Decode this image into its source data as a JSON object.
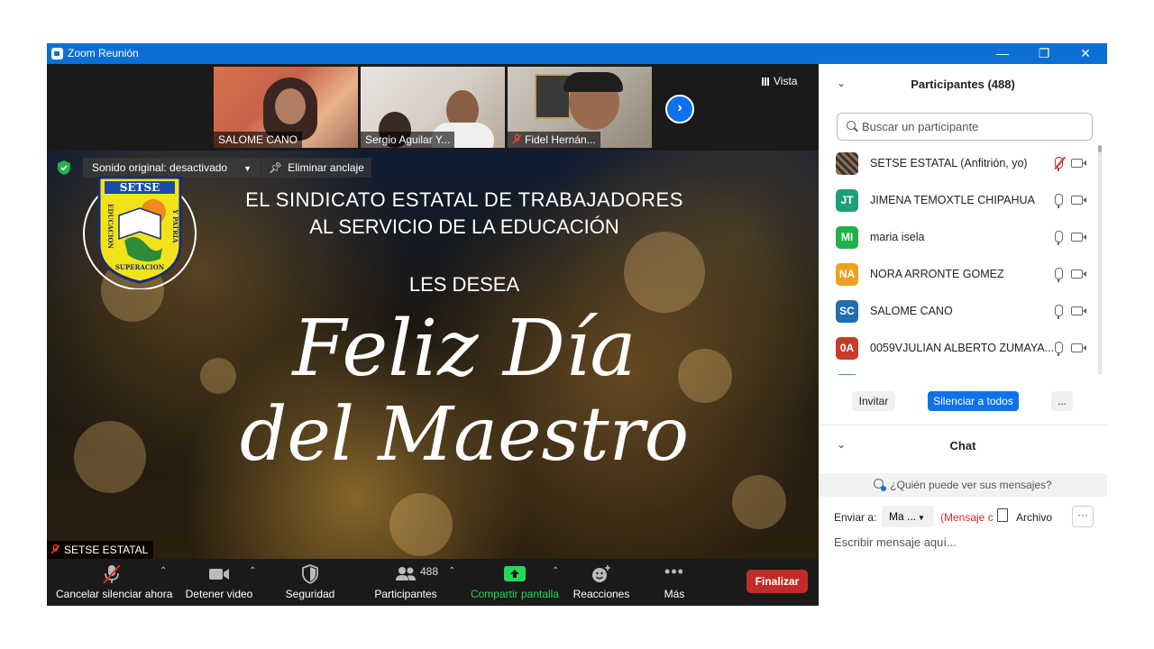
{
  "window": {
    "title": "Zoom Reunión",
    "controls": {
      "minimize": "—",
      "restore": "❐",
      "close": "✕"
    }
  },
  "gallery": {
    "tiles": [
      {
        "name": "SALOME CANO",
        "muted": false
      },
      {
        "name": "Sergio Aguilar Y...",
        "muted": false
      },
      {
        "name": "Fidel Hernán...",
        "muted": true
      }
    ],
    "next_icon": "chevron-right-icon",
    "view_label": "Vista"
  },
  "share": {
    "audio_bar": "Sonido original: desactivado",
    "unpin_label": "Eliminar anclaje",
    "logo_text": "SETSE",
    "logo_left": "EDUCACION",
    "logo_right": "Y PATRIA",
    "logo_bottom": "SUPERACION",
    "line1": "EL SINDICATO ESTATAL DE TRABAJADORES",
    "line2": "AL SERVICIO DE LA EDUCACIÓN",
    "line3": "LES DESEA",
    "script1": "Feliz Día",
    "script2": "del Maestro",
    "active_speaker": "SETSE ESTATAL"
  },
  "toolbar": {
    "mute_label": "Cancelar silenciar ahora",
    "video_label": "Detener video",
    "security_label": "Seguridad",
    "participants_label": "Participantes",
    "participants_count": "488",
    "share_label": "Compartir pantalla",
    "reactions_label": "Reacciones",
    "more_label": "Más",
    "end_label": "Finalizar",
    "share_color": "#23d959",
    "end_color": "#c32b2b"
  },
  "participants": {
    "title": "Participantes (488)",
    "search_placeholder": "Buscar un participante",
    "list": [
      {
        "initials": "",
        "name": "SETSE ESTATAL (Anfitrión, yo)",
        "color": "#5a4a3a",
        "muted": true
      },
      {
        "initials": "JT",
        "name": "JIMENA TEMOXTLE CHIPAHUA",
        "color": "#1f9e7a",
        "muted": false
      },
      {
        "initials": "MI",
        "name": "maria isela",
        "color": "#22b04a",
        "muted": false
      },
      {
        "initials": "NA",
        "name": "NORA ARRONTE GOMEZ",
        "color": "#f0a020",
        "muted": false
      },
      {
        "initials": "SC",
        "name": "SALOME CANO",
        "color": "#1f6eb0",
        "muted": false
      },
      {
        "initials": "0A",
        "name": "0059VJULIAN ALBERTO ZUMAYA...",
        "color": "#c83a2a",
        "muted": false
      }
    ],
    "invite_label": "Invitar",
    "mute_all_label": "Silenciar a todos",
    "more_label": "..."
  },
  "chat": {
    "title": "Chat",
    "who_can_see": "¿Quién puede ver sus mensajes?",
    "send_to_label": "Enviar a:",
    "recipient": "Ma ...",
    "warning": "(Mensaje c",
    "file_label": "Archivo",
    "more_label": "···",
    "compose_placeholder": "Escribir mensaje aquí..."
  }
}
